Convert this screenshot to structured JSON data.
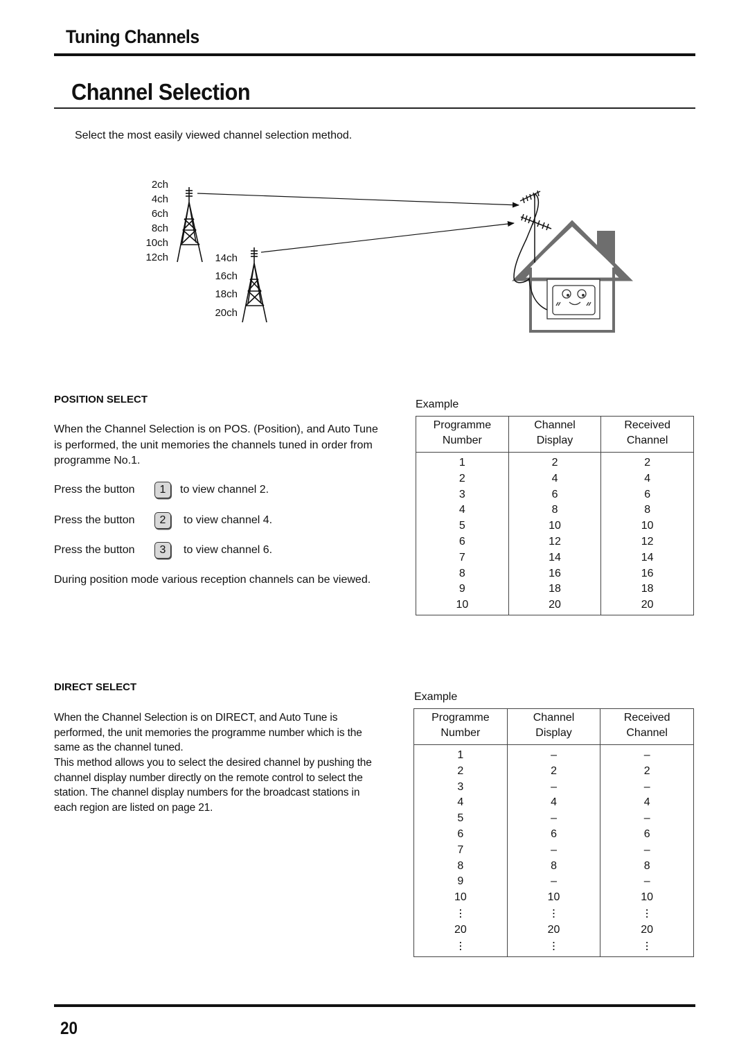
{
  "header": {
    "section_title": "Tuning Channels",
    "page_title": "Channel Selection",
    "intro": "Select the most easily viewed channel selection method."
  },
  "diagram": {
    "tower1_channels": [
      "2ch",
      "4ch",
      "6ch",
      "8ch",
      "10ch",
      "12ch"
    ],
    "tower2_channels": [
      "14ch",
      "16ch",
      "18ch",
      "20ch"
    ],
    "house_color": "#6e6e6e"
  },
  "position_select": {
    "heading": "POSITION SELECT",
    "description": "When the Channel Selection is on POS. (Position), and Auto Tune is performed, the unit memories the channels tuned in order from programme No.1.",
    "press_rows": [
      {
        "prefix": "Press the button",
        "key": "1",
        "suffix": "to view channel 2."
      },
      {
        "prefix": "Press the button",
        "key": "2",
        "suffix": "to view channel 4."
      },
      {
        "prefix": "Press the button",
        "key": "3",
        "suffix": "to view channel 6."
      }
    ],
    "note": "During position mode various reception channels can be viewed.",
    "example": {
      "label": "Example",
      "headers": [
        "Programme\nNumber",
        "Channel\nDisplay",
        "Received\nChannel"
      ],
      "rows": [
        [
          "1",
          "2",
          "2"
        ],
        [
          "2",
          "4",
          "4"
        ],
        [
          "3",
          "6",
          "6"
        ],
        [
          "4",
          "8",
          "8"
        ],
        [
          "5",
          "10",
          "10"
        ],
        [
          "6",
          "12",
          "12"
        ],
        [
          "7",
          "14",
          "14"
        ],
        [
          "8",
          "16",
          "16"
        ],
        [
          "9",
          "18",
          "18"
        ],
        [
          "10",
          "20",
          "20"
        ]
      ]
    }
  },
  "direct_select": {
    "heading": "DIRECT SELECT",
    "description": "When the Channel Selection is on DIRECT, and Auto Tune is performed, the unit memories the programme number which is the same as the channel tuned.",
    "description2": "This method allows you to select the desired channel by pushing the channel display number directly on the remote control to select the station. The channel display numbers for the broadcast stations in each region are listed on page 21.",
    "example": {
      "label": "Example",
      "headers": [
        "Programme\nNumber",
        "Channel\nDisplay",
        "Received\nChannel"
      ],
      "rows": [
        [
          "1",
          "–",
          "–"
        ],
        [
          "2",
          "2",
          "2"
        ],
        [
          "3",
          "–",
          "–"
        ],
        [
          "4",
          "4",
          "4"
        ],
        [
          "5",
          "–",
          "–"
        ],
        [
          "6",
          "6",
          "6"
        ],
        [
          "7",
          "–",
          "–"
        ],
        [
          "8",
          "8",
          "8"
        ],
        [
          "9",
          "–",
          "–"
        ],
        [
          "10",
          "10",
          "10"
        ],
        [
          "⋮",
          "⋮",
          "⋮"
        ],
        [
          "20",
          "20",
          "20"
        ],
        [
          "⋮",
          "⋮",
          "⋮"
        ]
      ]
    }
  },
  "footer": {
    "page_number": "20"
  }
}
